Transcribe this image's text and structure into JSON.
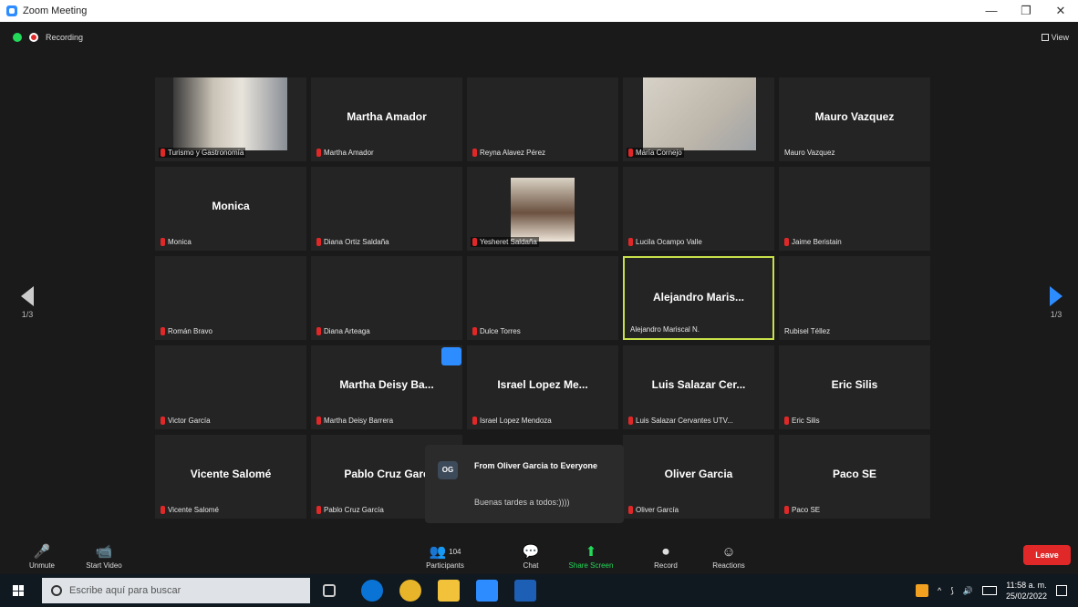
{
  "window": {
    "title": "Zoom Meeting",
    "minimize": "—",
    "restore": "❐",
    "close": "✕"
  },
  "status": {
    "recording": "Recording",
    "view": "View"
  },
  "nav": {
    "left_page": "1/3",
    "right_page": "1/3"
  },
  "tiles": [
    {
      "big": "",
      "name": "Turismo y Gastronomía",
      "muted": true,
      "video": true
    },
    {
      "big": "Martha Amador",
      "name": "Martha Amador",
      "muted": true
    },
    {
      "big": "",
      "name": "Reyna Alavez Pérez",
      "muted": true
    },
    {
      "big": "",
      "name": "María Cornejo",
      "muted": true,
      "video": true
    },
    {
      "big": "Mauro Vazquez",
      "name": "Mauro Vazquez",
      "muted": false
    },
    {
      "big": "Monica",
      "name": "Monica",
      "muted": true
    },
    {
      "big": "",
      "name": "Diana Ortiz Saldaña",
      "muted": true
    },
    {
      "big": "",
      "name": "Yesheret Saldaña",
      "muted": true,
      "video": true
    },
    {
      "big": "",
      "name": "Lucila Ocampo Valle",
      "muted": true
    },
    {
      "big": "",
      "name": "Jaime Beristain",
      "muted": true
    },
    {
      "big": "",
      "name": "Román Bravo",
      "muted": true
    },
    {
      "big": "",
      "name": "Diana Arteaga",
      "muted": true
    },
    {
      "big": "",
      "name": "Dulce Torres",
      "muted": true
    },
    {
      "big": "Alejandro  Maris...",
      "name": "Alejandro Mariscal N.",
      "muted": false,
      "active": true
    },
    {
      "big": "",
      "name": "Rubisel Téllez",
      "muted": false
    },
    {
      "big": "",
      "name": "Victor García",
      "muted": true
    },
    {
      "big": "Martha Deisy Ba...",
      "name": "Martha Deisy Barrera",
      "muted": true
    },
    {
      "big": "Israel Lopez Me...",
      "name": "Israel Lopez Mendoza",
      "muted": true
    },
    {
      "big": "Luis Salazar Cer...",
      "name": "Luis Salazar Cervantes UTV...",
      "muted": true
    },
    {
      "big": "Eric Silis",
      "name": "Eric Silis",
      "muted": true
    },
    {
      "big": "Vicente Salomé",
      "name": "Vicente Salomé",
      "muted": true
    },
    {
      "big": "Pablo Cruz Garc",
      "name": "Pablo Cruz García",
      "muted": true
    },
    {
      "big": "",
      "name": "",
      "muted": false,
      "hidden": true
    },
    {
      "big": "Oliver Garcia",
      "name": "Oliver García",
      "muted": true
    },
    {
      "big": "Paco SE",
      "name": "Paco SE",
      "muted": true
    }
  ],
  "chat_popup": {
    "avatar": "OG",
    "from": "From Oliver Garcia to Everyone",
    "message": "Buenas tardes a todos:))))"
  },
  "toolbar": {
    "unmute": "Unmute",
    "start_video": "Start Video",
    "participants": "Participants",
    "participants_count": "104",
    "chat": "Chat",
    "share_screen": "Share Screen",
    "record": "Record",
    "reactions": "Reactions",
    "leave": "Leave"
  },
  "taskbar": {
    "search_placeholder": "Escribe aquí para buscar",
    "time": "11:58 a. m.",
    "date": "25/02/2022"
  },
  "colors": {
    "active_speaker": "#c8e04a",
    "leave": "#e02828",
    "share": "#23d959",
    "accent": "#2d8cff"
  }
}
